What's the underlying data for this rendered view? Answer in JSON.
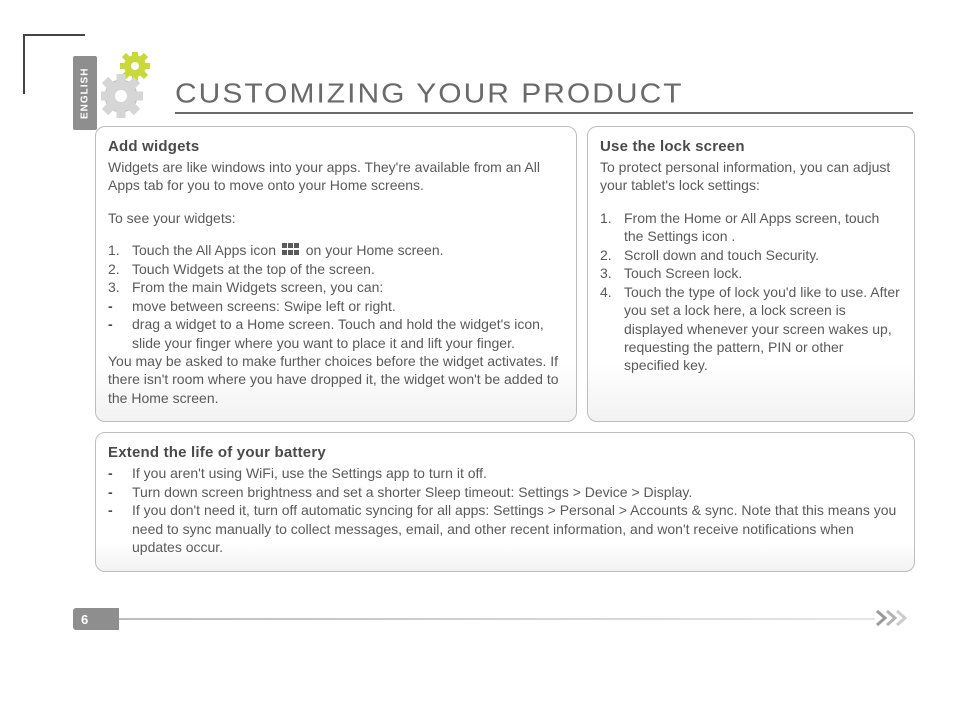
{
  "lang_label": "ENGLISH",
  "title": "CUSTOMIZING YOUR PRODUCT",
  "page_number": "6",
  "panels": {
    "widgets": {
      "heading": "Add widgets",
      "intro": "Widgets are like windows into your apps. They're available from an All Apps tab for you to move onto your Home screens.",
      "lead": "To see your widgets:",
      "num": {
        "i1a": "Touch the All Apps icon ",
        "i1b": " on your Home screen.",
        "i2": "Touch Widgets at the top of the screen.",
        "i3": "From the main Widgets screen, you can:"
      },
      "dash": {
        "d1": " move between screens: Swipe left or right.",
        "d2": "drag a widget to a Home screen. Touch and hold the widget's icon, slide your finger where you want to place it and lift your finger."
      },
      "outro": "You may be asked to make further choices before the widget activates. If there isn't room where you have dropped it, the widget won't be added to the Home screen."
    },
    "lock": {
      "heading": "Use the lock screen",
      "intro": "To protect personal information, you can adjust your tablet's lock settings:",
      "num": {
        "i1": "From the Home or All Apps screen, touch the Settings icon .",
        "i2": "Scroll down and touch Security.",
        "i3": "Touch Screen lock.",
        "i4": "Touch the type of lock you'd like to use. After you set a lock here, a lock screen is displayed whenever your screen wakes up, requesting the pattern, PIN or other specified key."
      }
    },
    "battery": {
      "heading": "Extend the life of your battery",
      "dash": {
        "d1": "If you aren't using WiFi, use the Settings app to turn it off.",
        "d2": "Turn down screen brightness and set a shorter Sleep timeout: Settings > Device > Display.",
        "d3": "If you don't need it, turn off automatic syncing for all apps: Settings > Personal > Accounts & sync. Note that this means you need to sync manually to collect messages, email, and other recent information, and won't receive notifications when updates occur."
      }
    }
  }
}
